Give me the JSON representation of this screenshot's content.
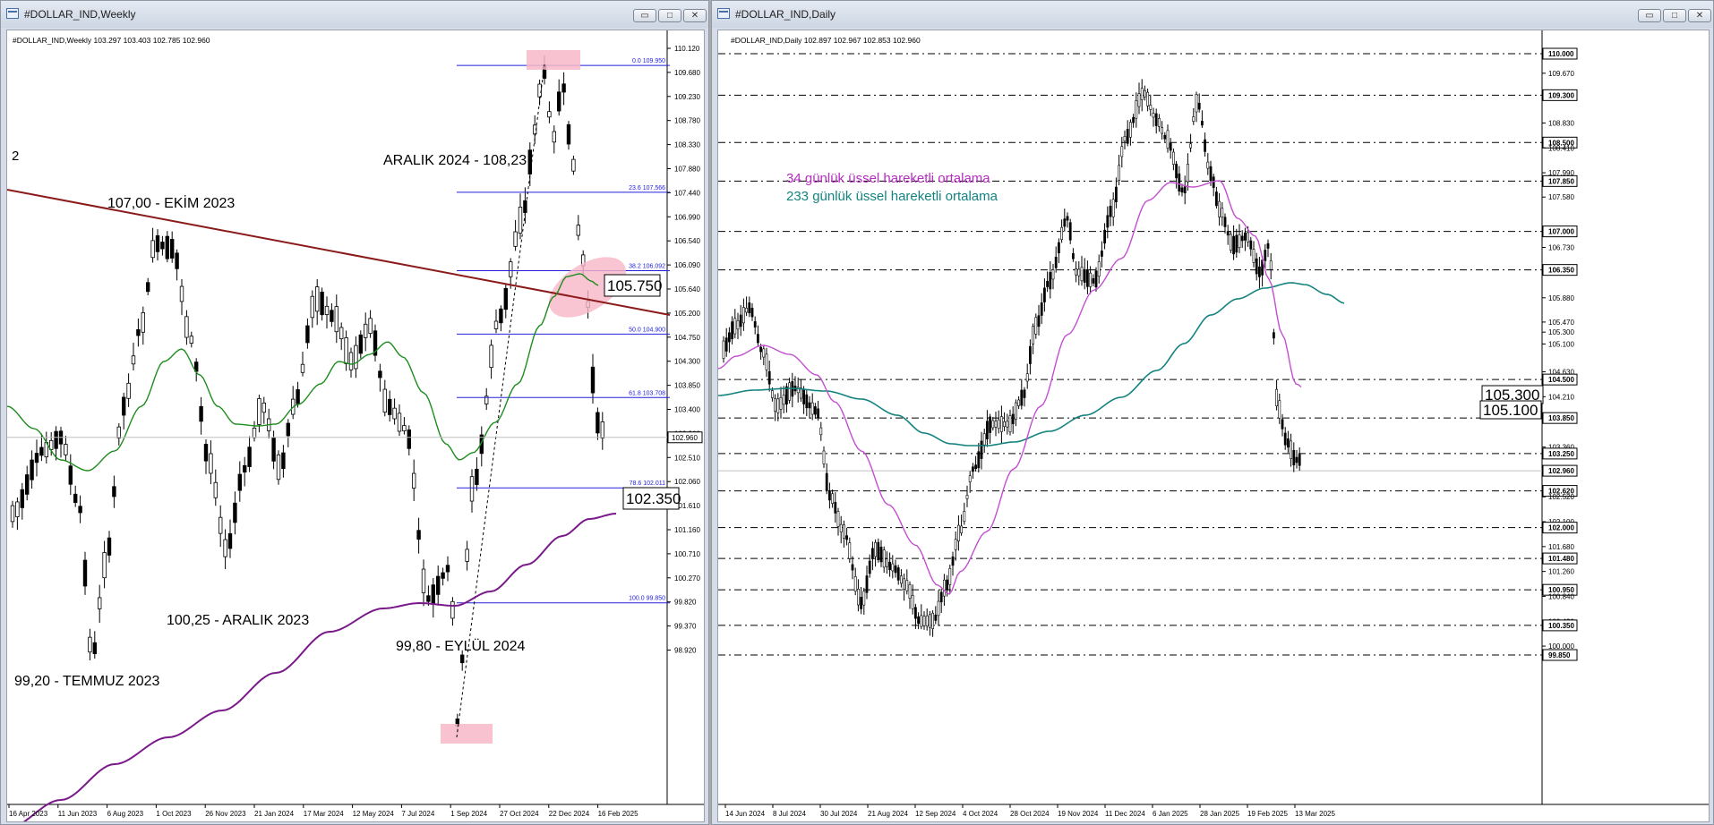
{
  "windows": [
    {
      "title": "#DOLLAR_IND,Weekly",
      "buttons": {
        "minimize": "▭",
        "maximize": "□",
        "close": "✕"
      },
      "header": "#DOLLAR_IND,Weekly  103.297 103.403 102.785 102.960",
      "side_label": "2",
      "price_labels": [
        "110.120",
        "109.680",
        "109.230",
        "108.780",
        "108.330",
        "107.880",
        "107.440",
        "106.990",
        "106.540",
        "106.090",
        "105.640",
        "105.200",
        "104.750",
        "104.300",
        "103.850",
        "103.400",
        "102.960",
        "102.510",
        "102.060",
        "101.610",
        "101.160",
        "100.710",
        "100.270",
        "99.820",
        "99.370",
        "98.920"
      ],
      "current_price": "102.960",
      "time_labels": [
        "16 Apr 2023",
        "11 Jun 2023",
        "6 Aug 2023",
        "1 Oct 2023",
        "26 Nov 2023",
        "21 Jan 2024",
        "17 Mar 2024",
        "12 May 2024",
        "7 Jul 2024",
        "1 Sep 2024",
        "27 Oct 2024",
        "22 Dec 2024",
        "16 Feb 2025"
      ],
      "fib_levels": [
        {
          "label": "0.0 109.950",
          "price": 109.95
        },
        {
          "label": "23.6 107.566",
          "price": 107.566
        },
        {
          "label": "38.2 106.092",
          "price": 106.092
        },
        {
          "label": "50.0 104.900",
          "price": 104.9
        },
        {
          "label": "61.8 103.708",
          "price": 103.708
        },
        {
          "label": "78.6 102.011",
          "price": 102.011
        },
        {
          "label": "100.0 99.850",
          "price": 99.85
        }
      ],
      "annotations": {
        "a1": "ARALIK 2024 - 108,23",
        "a2": "107,00 - EKİM 2023",
        "a3": "100,25 - ARALIK 2023",
        "a4": "99,80 - EYLÜL 2024",
        "a5": "99,20 - TEMMUZ 2023"
      },
      "value_boxes": [
        "105.750",
        "102.350"
      ]
    },
    {
      "title": "#DOLLAR_IND,Daily",
      "buttons": {
        "minimize": "▭",
        "maximize": "□",
        "close": "✕"
      },
      "header": "#DOLLAR_IND,Daily  102.897 102.967 102.853 102.960",
      "price_labels": [
        "110.000",
        "109.670",
        "109.300",
        "108.830",
        "108.500",
        "108.410",
        "107.990",
        "107.850",
        "107.580",
        "107.000",
        "106.730",
        "106.350",
        "105.880",
        "105.470",
        "105.300",
        "105.100",
        "104.630",
        "104.500",
        "104.210",
        "103.850",
        "103.360",
        "103.250",
        "102.960",
        "102.620",
        "102.520",
        "102.100",
        "102.000",
        "101.680",
        "101.480",
        "101.260",
        "100.950",
        "100.840",
        "100.420",
        "100.350",
        "100.000",
        "99.850"
      ],
      "highlighted_labels": [
        "110.000",
        "109.300",
        "108.500",
        "107.850",
        "107.000",
        "106.350",
        "104.500",
        "103.850",
        "103.250",
        "102.960",
        "102.620",
        "102.000",
        "101.480",
        "100.950",
        "100.350",
        "99.850"
      ],
      "time_labels": [
        "14 Jun 2024",
        "8 Jul 2024",
        "30 Jul 2024",
        "21 Aug 2024",
        "12 Sep 2024",
        "4 Oct 2024",
        "28 Oct 2024",
        "19 Nov 2024",
        "11 Dec 2024",
        "6 Jan 2025",
        "28 Jan 2025",
        "19 Feb 2025",
        "13 Mar 2025"
      ],
      "legend": {
        "ema34": "34 günlük üssel hareketli ortalama",
        "ema233": "233 günlük üssel hareketli ortalama"
      },
      "value_boxes": [
        "105.300",
        "105.100"
      ]
    }
  ],
  "colors": {
    "trendline": "#8b1a1a",
    "ma_green": "#1e8c1e",
    "ma_purple": "#7a1a8a",
    "ma34_daily": "#c34fd0",
    "ma233_daily": "#14837f",
    "fib": "#2222dd",
    "highlight": "#f7b7c8"
  }
}
